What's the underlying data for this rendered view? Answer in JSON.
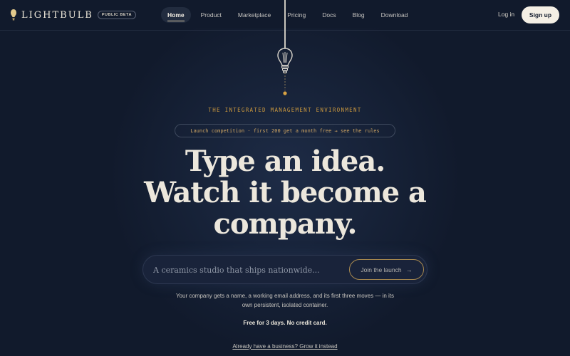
{
  "brand": {
    "name": "LIGHTBULB",
    "badge": "PUBLIC BETA",
    "icon": "lightbulb-icon"
  },
  "nav": {
    "items": [
      {
        "label": "Home",
        "active": true
      },
      {
        "label": "Product"
      },
      {
        "label": "Marketplace"
      },
      {
        "label": "Pricing"
      },
      {
        "label": "Docs"
      },
      {
        "label": "Blog"
      },
      {
        "label": "Download"
      }
    ],
    "login": "Log in",
    "signup": "Sign up"
  },
  "hero": {
    "eyebrow": "THE INTEGRATED MANAGEMENT ENVIRONMENT",
    "pill": "Launch competition · first 200 get a month free → see the rules",
    "headline": [
      "Type an idea.",
      "Watch it become a",
      "company."
    ],
    "search": {
      "placeholder": "A ceramics studio that ships nationwide...",
      "button": "Join the launch",
      "button_arrow": "→"
    },
    "description": "Your company gets a name, a working email address, and its first three moves — in its own persistent, isolated container.",
    "free_note": "Free for 3 days. No credit card.",
    "already_link": "Already have a business? Grow it instead"
  },
  "colors": {
    "background": "#111a2c",
    "accent": "#c9973e",
    "text": "#ece7dc",
    "button_bg": "#f4efe5"
  }
}
